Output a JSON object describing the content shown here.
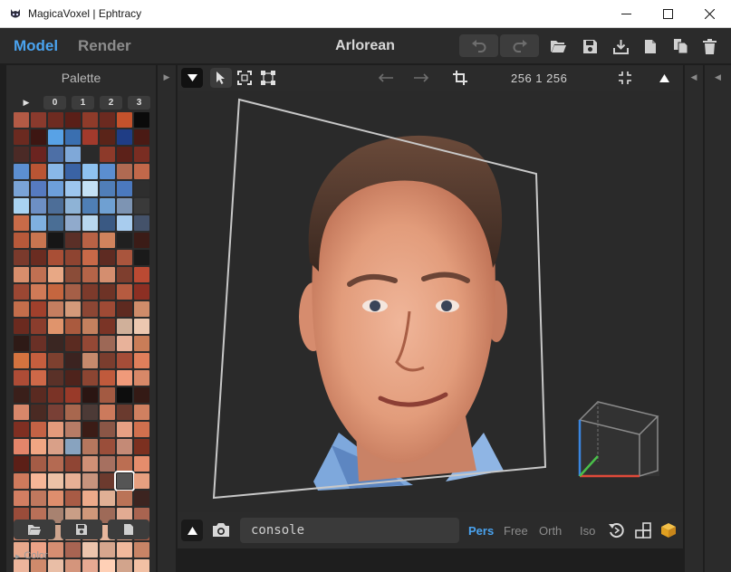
{
  "window": {
    "title": "MagicaVoxel | Ephtracy",
    "minimize_icon": "minimize-icon",
    "maximize_icon": "maximize-icon",
    "close_icon": "close-icon"
  },
  "top_toolbar": {
    "mode_tabs": [
      {
        "label": "Model",
        "active": true
      },
      {
        "label": "Render",
        "active": false
      }
    ],
    "document_title": "Arlorean",
    "icons": [
      "undo-icon",
      "redo-icon",
      "open-folder-icon",
      "save-icon",
      "export-icon",
      "new-file-icon",
      "duplicate-icon",
      "delete-icon"
    ]
  },
  "palette": {
    "title": "Palette",
    "page_tabs": [
      "0",
      "1",
      "2",
      "3"
    ],
    "selected_index": 174,
    "colors": [
      "#b35a45",
      "#8a3a2d",
      "#6e2b21",
      "#5a1f18",
      "#8e3b2a",
      "#6b2a20",
      "#c4522c",
      "#0a0a0a",
      "#6b2a20",
      "#3d1612",
      "#58a2e6",
      "#3a6fb0",
      "#a23a2c",
      "#5a2419",
      "#1f3d85",
      "#4a1a14",
      "#4b2a26",
      "#6b2420",
      "#4d6fa6",
      "#7fa8d8",
      "#2a2a2a",
      "#8d3a2a",
      "#5c2119",
      "#7a2d22",
      "#5c8fd1",
      "#b95534",
      "#89b8e8",
      "#3a63a5",
      "#8ec2f0",
      "#5b8ed0",
      "#b06a52",
      "#c2684a",
      "#7aa3d6",
      "#567ac0",
      "#6d9fda",
      "#9dc6ee",
      "#c4e1f5",
      "#507eb8",
      "#4b79be",
      "#2e2e2e",
      "#a9d3f2",
      "#6d8fc4",
      "#4d6e98",
      "#8eb3d6",
      "#4f7fb5",
      "#6fa0d2",
      "#7d94b3",
      "#3a3a3a",
      "#c86b48",
      "#7fb0e0",
      "#4a6e95",
      "#90aacc",
      "#b8d7ee",
      "#3a5983",
      "#a8ccee",
      "#44526a",
      "#b7593a",
      "#c87550",
      "#161616",
      "#5a2f27",
      "#b86245",
      "#d0835d",
      "#202020",
      "#3b1c17",
      "#7a3a2c",
      "#6a2c21",
      "#a94f36",
      "#8e4431",
      "#c86948",
      "#5e2b22",
      "#a9553d",
      "#1a1a1a",
      "#d88e6c",
      "#c07052",
      "#e8a885",
      "#8a4c38",
      "#b46448",
      "#d48e6f",
      "#7e3e2e",
      "#bb4a33",
      "#9b4733",
      "#d07a57",
      "#c5663f",
      "#a55f47",
      "#7c3a2b",
      "#6e3326",
      "#b65b40",
      "#8c2f23",
      "#c46e4b",
      "#a0402c",
      "#c57e60",
      "#d49a7a",
      "#8c4634",
      "#9e4a35",
      "#5e2a20",
      "#cf8c6a",
      "#6b2a1f",
      "#8a3d2d",
      "#e0946c",
      "#aa5a3e",
      "#c4805e",
      "#7a3426",
      "#d0b09a",
      "#ecc8b0",
      "#2e1a16",
      "#6a3026",
      "#3a2622",
      "#5b2b21",
      "#944835",
      "#9d6856",
      "#e8b29a",
      "#c97d58",
      "#d4733f",
      "#c55e3e",
      "#7d402f",
      "#3b2320",
      "#c68a6c",
      "#7a3d2e",
      "#a54d38",
      "#e07f5b",
      "#ad4c36",
      "#ce6848",
      "#5a3128",
      "#4e231c",
      "#8c4532",
      "#c05a3c",
      "#f09a7a",
      "#d88868",
      "#3a1f1a",
      "#5a2a21",
      "#7a3326",
      "#993a29",
      "#2a1512",
      "#a35a42",
      "#0d0d0d",
      "#341a15",
      "#d8876a",
      "#4a2a23",
      "#794036",
      "#a8674e",
      "#4c3a36",
      "#cc7a5c",
      "#6a3a2e",
      "#d08060",
      "#7f2f22",
      "#c46245",
      "#e39b7c",
      "#b77c66",
      "#3b1c16",
      "#8a5646",
      "#e6a084",
      "#d0704e",
      "#e4856a",
      "#f0a683",
      "#d9a088",
      "#88a3bf",
      "#b5775e",
      "#9a4e3a",
      "#c48a76",
      "#7c3020",
      "#5c1f17",
      "#a45c46",
      "#b46a52",
      "#8f4534",
      "#d09076",
      "#a67060",
      "#bb6e52",
      "#e58d6c",
      "#cf7a5c",
      "#f6b697",
      "#ecc2a7",
      "#e7b095",
      "#c7947d",
      "#6c3a2e",
      "#555555",
      "#e6a080",
      "#d27e62",
      "#c0785e",
      "#de8e6d",
      "#a85b45",
      "#ecaa8a",
      "#e0b095",
      "#ba7357",
      "#3c2420",
      "#9a4c3a",
      "#b97058",
      "#a88270",
      "#c99e86",
      "#cf987a",
      "#9e6a58",
      "#e2ab92",
      "#a96450",
      "#c48068",
      "#e2a088",
      "#cfa58e",
      "#d79e84",
      "#d49478",
      "#e8b69c",
      "#cf9c84",
      "#a05a44",
      "#e7a88c",
      "#eda387",
      "#d68e72",
      "#a86452",
      "#ecc4ac",
      "#d6a68e",
      "#f0b89c",
      "#c88466",
      "#ecb59c",
      "#cf8a6c",
      "#e9bea6",
      "#d4957c",
      "#e6a992",
      "#ffd0b6",
      "#d2a48c",
      "#f2c0a4",
      "#efb89c",
      "#dba58a",
      "#d7b39c",
      "#d9987c",
      "#f6ccb4",
      "#e6b49e",
      "#dba28a",
      "#ebb79e",
      "#cca48e",
      "#e9c0a8",
      "#f0c7ae",
      "#d8a690",
      "#f3cdb6",
      "#c7a08c",
      "#ebbda6",
      "#a88674",
      "#e0c0ac",
      "#b7987f",
      "#d5b39f",
      "#c9a592",
      "#b59a8c",
      "#d9b8a3",
      "#dcc0ad",
      "#cfb09c",
      "#f6dac6",
      "#9d7a6a",
      "#e7c9b5",
      "#c8ad9c",
      "#b09888",
      "#dec2ae",
      "#c0a290",
      "#8b7666"
    ],
    "actions": [
      "open-folder-icon",
      "save-icon",
      "new-file-icon"
    ],
    "color_section_label": "Color"
  },
  "viewport_toolbar": {
    "icons": [
      "chevron-down-icon",
      "select-cursor-icon",
      "select-box-icon",
      "select-all-icon",
      "arrow-left-icon",
      "arrow-right-icon",
      "crop-icon",
      "collapse-icon",
      "triangle-up-icon"
    ],
    "size_label": "256  1  256"
  },
  "bottom_bar": {
    "console_value": "console",
    "projections": [
      {
        "label": "Pers",
        "active": true
      },
      {
        "label": "Free",
        "active": false
      },
      {
        "label": "Orth",
        "active": false
      },
      {
        "label": "Iso",
        "active": false
      }
    ],
    "icons": [
      "triangle-up-icon",
      "camera-icon",
      "reset-view-icon",
      "grid-icon",
      "cube-icon"
    ]
  },
  "colors": {
    "accent": "#4aa3ef",
    "panel": "#2b2b2b",
    "background": "#1e1e1e",
    "viewport": "#2a2a2a"
  }
}
